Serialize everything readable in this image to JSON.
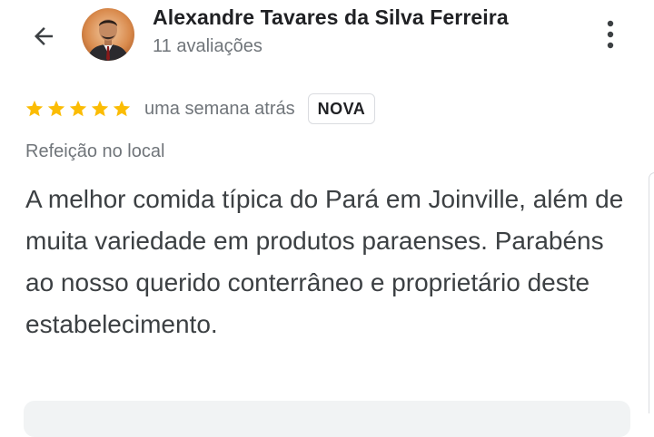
{
  "header": {
    "back_icon": "arrow-back-icon",
    "avatar_icon": "user-avatar-photo",
    "reviewer_name": "Alexandre Tavares da Silva Ferreira",
    "review_count": "11 avaliações",
    "more_icon": "more-vert-icon"
  },
  "review": {
    "rating": 5,
    "rating_max": 5,
    "star_icon": "star-icon",
    "star_color": "#fbbc04",
    "time": "uma semana atrás",
    "badge": "NOVA",
    "service_type": "Refeição no local",
    "text": "A melhor comida típica do Pará em Joinville, além de muita variedade em produtos paraenses. Parabéns ao nosso querido conterrâneo e proprietário deste estabelecimento."
  },
  "colors": {
    "primary_text": "#202124",
    "secondary_text": "#70757a",
    "body_text": "#3c4043"
  }
}
